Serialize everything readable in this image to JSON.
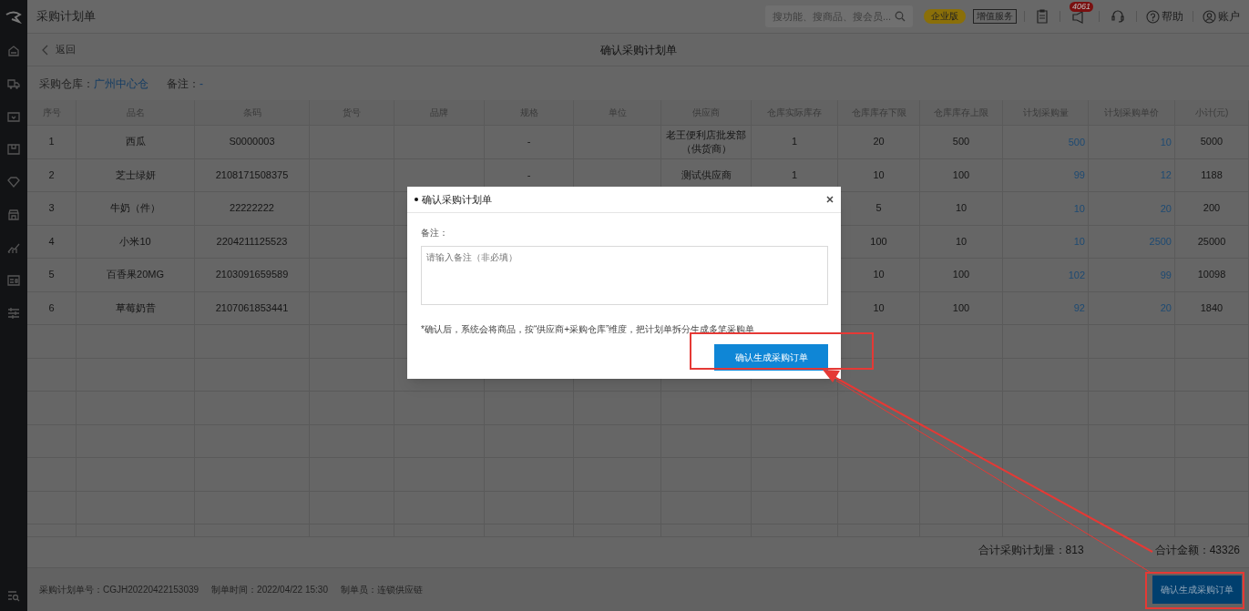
{
  "app": {
    "title": "采购计划单"
  },
  "topbar": {
    "search": {
      "placeholder": "搜功能、搜商品、搜会员..."
    },
    "edition_badge": "企业版",
    "value_added": "增值服务",
    "notification_count": "4061",
    "help": "帮助",
    "account": "账户"
  },
  "page": {
    "back": "返回",
    "title": "确认采购计划单"
  },
  "info": {
    "warehouse_label": "采购仓库：",
    "warehouse": "广州中心仓",
    "remark_label": "备注：",
    "remark": "-"
  },
  "table": {
    "columns": [
      "序号",
      "品名",
      "条码",
      "货号",
      "品牌",
      "规格",
      "单位",
      "供应商",
      "仓库实际库存",
      "仓库库存下限",
      "仓库库存上限",
      "计划采购量",
      "计划采购单价",
      "小计(元)"
    ],
    "rows": [
      {
        "index": "1",
        "name": "西瓜",
        "barcode": "S0000003",
        "spec": "-",
        "supplier": "老王便利店批发部（供货商）",
        "stock": "1",
        "min": "20",
        "max": "500",
        "qty": "500",
        "price": "10",
        "subtotal": "5000"
      },
      {
        "index": "2",
        "name": "芝士绿妍",
        "barcode": "2108171508375",
        "spec": "-",
        "supplier": "测试供应商",
        "stock": "1",
        "min": "10",
        "max": "100",
        "qty": "99",
        "price": "12",
        "subtotal": "1188"
      },
      {
        "index": "3",
        "name": "牛奶（件）",
        "barcode": "22222222",
        "min": "5",
        "max": "10",
        "qty": "10",
        "price": "20",
        "subtotal": "200"
      },
      {
        "index": "4",
        "name": "小米10",
        "barcode": "2204211125523",
        "min": "100",
        "max": "10",
        "qty": "10",
        "price": "2500",
        "subtotal": "25000"
      },
      {
        "index": "5",
        "name": "百香果20MG",
        "barcode": "2103091659589",
        "min": "10",
        "max": "100",
        "qty": "102",
        "price": "99",
        "subtotal": "10098"
      },
      {
        "index": "6",
        "name": "草莓奶昔",
        "barcode": "2107061853441",
        "min": "10",
        "max": "100",
        "qty": "92",
        "price": "20",
        "subtotal": "1840"
      }
    ]
  },
  "summary": {
    "total_qty": "合计采购计划量：813",
    "total_amount": "合计金额：43326"
  },
  "footer": {
    "plan_no": "采购计划单号：CGJH20220422153039",
    "created": "制单时间：2022/04/22 15:30",
    "maker": "制单员：连锁供应链",
    "button": "确认生成采购订单"
  },
  "modal": {
    "title": "确认采购计划单",
    "remark_label": "备注：",
    "placeholder": "请输入备注（非必填）",
    "note": "*确认后，系统会将商品，按“供应商+采购仓库”维度，把计划单拆分生成多笔采购单",
    "button": "确认生成采购订单"
  }
}
